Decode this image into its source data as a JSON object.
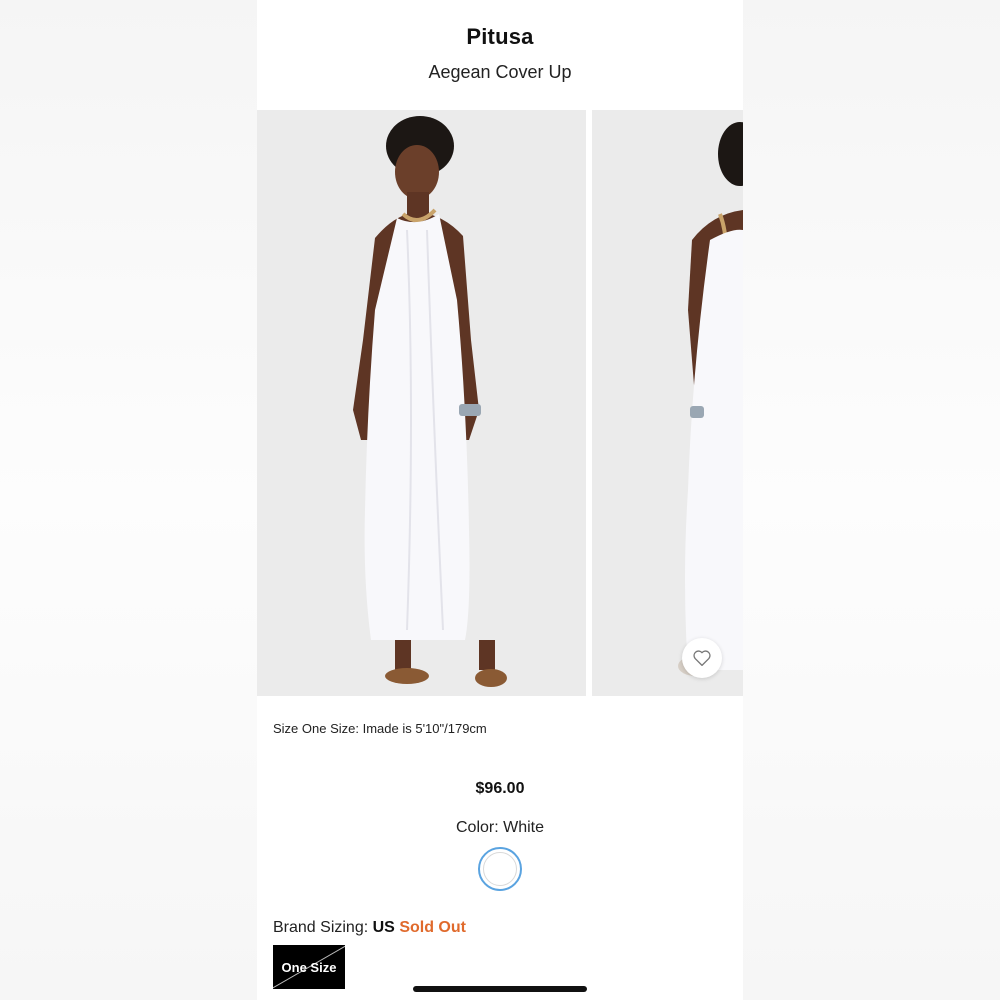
{
  "header": {
    "brand": "Pitusa",
    "product_name": "Aegean Cover Up"
  },
  "gallery": {
    "images": [
      "model-front-photo",
      "model-back-photo"
    ],
    "favorite_icon": "heart-icon"
  },
  "details": {
    "size_note": "Size One Size: Imade is 5'10\"/179cm",
    "price": "$96.00",
    "color_label": "Color: White",
    "color_swatch": "#ffffff",
    "brand_sizing_label": "Brand Sizing:",
    "brand_sizing_region": "US",
    "availability": "Sold Out",
    "sizes": [
      "One Size"
    ]
  },
  "colors": {
    "soldout": "#e06a2c",
    "swatch_ring": "#5aa3e0",
    "size_chip_bg": "#000000"
  }
}
